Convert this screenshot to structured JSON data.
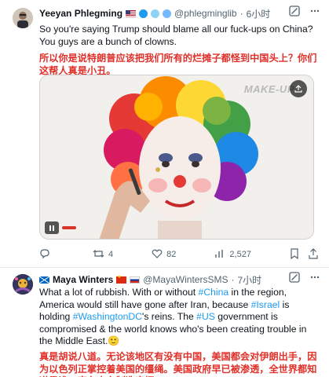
{
  "tweet1": {
    "name": "Yeeyan Phlegming",
    "handle": "@phlegminglib",
    "dot": "·",
    "time": "6小时",
    "text_en": "So you're saying Trump should blame all our fuck-ups on China? You guys are a bunch of clowns.",
    "text_cn": "所以你是说特朗普应该把我们所有的烂摊子都怪到中国头上？你们这帮人真是小丑。",
    "video": {
      "watermark": "MAKE-UP"
    },
    "stats": {
      "replies": "",
      "retweets": "4",
      "likes": "82",
      "views": "2,527"
    }
  },
  "tweet2": {
    "name": "Maya Winters",
    "handle": "@MayaWintersSMS",
    "dot": "·",
    "time": "7小时",
    "text_p1": "What a lot of rubbish. With or without ",
    "tag1": "#China",
    "text_p2": " in the region, America would still have gone after Iran, because ",
    "tag2": "#Israel",
    "text_p3": " is holding ",
    "tag3": "#WashingtonDC",
    "text_p4": "'s reins. The ",
    "tag4": "#US",
    "text_p5": " government is compromised & the world knows who's been creating trouble in the Middle East.",
    "emoji": "🙂",
    "text_cn": "真是胡说八道。无论该地区有没有中国，美国都会对伊朗出手，因为以色列正掌控着美国的缰绳。美国政府早已被渗透，全世界都知道是谁一直在中东制造麻烦。"
  },
  "colors": {
    "accent": "#1d9bf0",
    "chinese_text": "#e0302a",
    "secondary": "#536471"
  },
  "icons": [
    "grok-icon",
    "more-icon",
    "reply-icon",
    "retweet-icon",
    "like-icon",
    "views-icon",
    "share-icon",
    "pause-icon",
    "verified-icon"
  ]
}
